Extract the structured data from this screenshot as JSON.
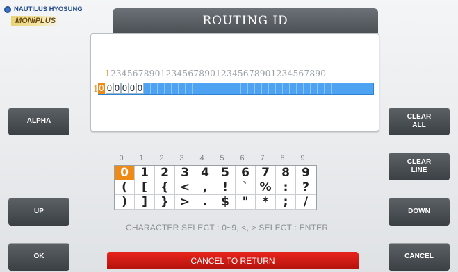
{
  "brand": {
    "company": "NAUTILUS HYOSUNG",
    "product": "MONiPLUS"
  },
  "title": "ROUTING ID",
  "display": {
    "ruler_first": "1",
    "ruler_rest": "234567890123456789012345678901234567890",
    "row_number": "1",
    "active_char": "0",
    "entered_chars": [
      "0",
      "0",
      "0",
      "0",
      "0"
    ]
  },
  "buttons": {
    "alpha": "ALPHA",
    "up": "UP",
    "ok": "OK",
    "clear_all": "CLEAR\nALL",
    "clear_line": "CLEAR\nLINE",
    "down": "DOWN",
    "cancel": "CANCEL"
  },
  "keyboard": {
    "column_headers": [
      "0",
      "1",
      "2",
      "3",
      "4",
      "5",
      "6",
      "7",
      "8",
      "9"
    ],
    "rows": [
      [
        "0",
        "1",
        "2",
        "3",
        "4",
        "5",
        "6",
        "7",
        "8",
        "9"
      ],
      [
        "(",
        "[",
        "{",
        "<",
        ",",
        "!",
        "`",
        "%",
        ":",
        "?"
      ],
      [
        ")",
        "]",
        "}",
        ">",
        ".",
        "$",
        "\"",
        "*",
        ";",
        "/"
      ]
    ],
    "selected": "0"
  },
  "hint": "CHARACTER SELECT : 0~9, <, >  SELECT : ENTER",
  "cancel_to_return": "CANCEL TO RETURN",
  "colors": {
    "accent": "#ee8a16",
    "input_fill": "#4da3f1",
    "cancel_red": "#d41c15"
  }
}
